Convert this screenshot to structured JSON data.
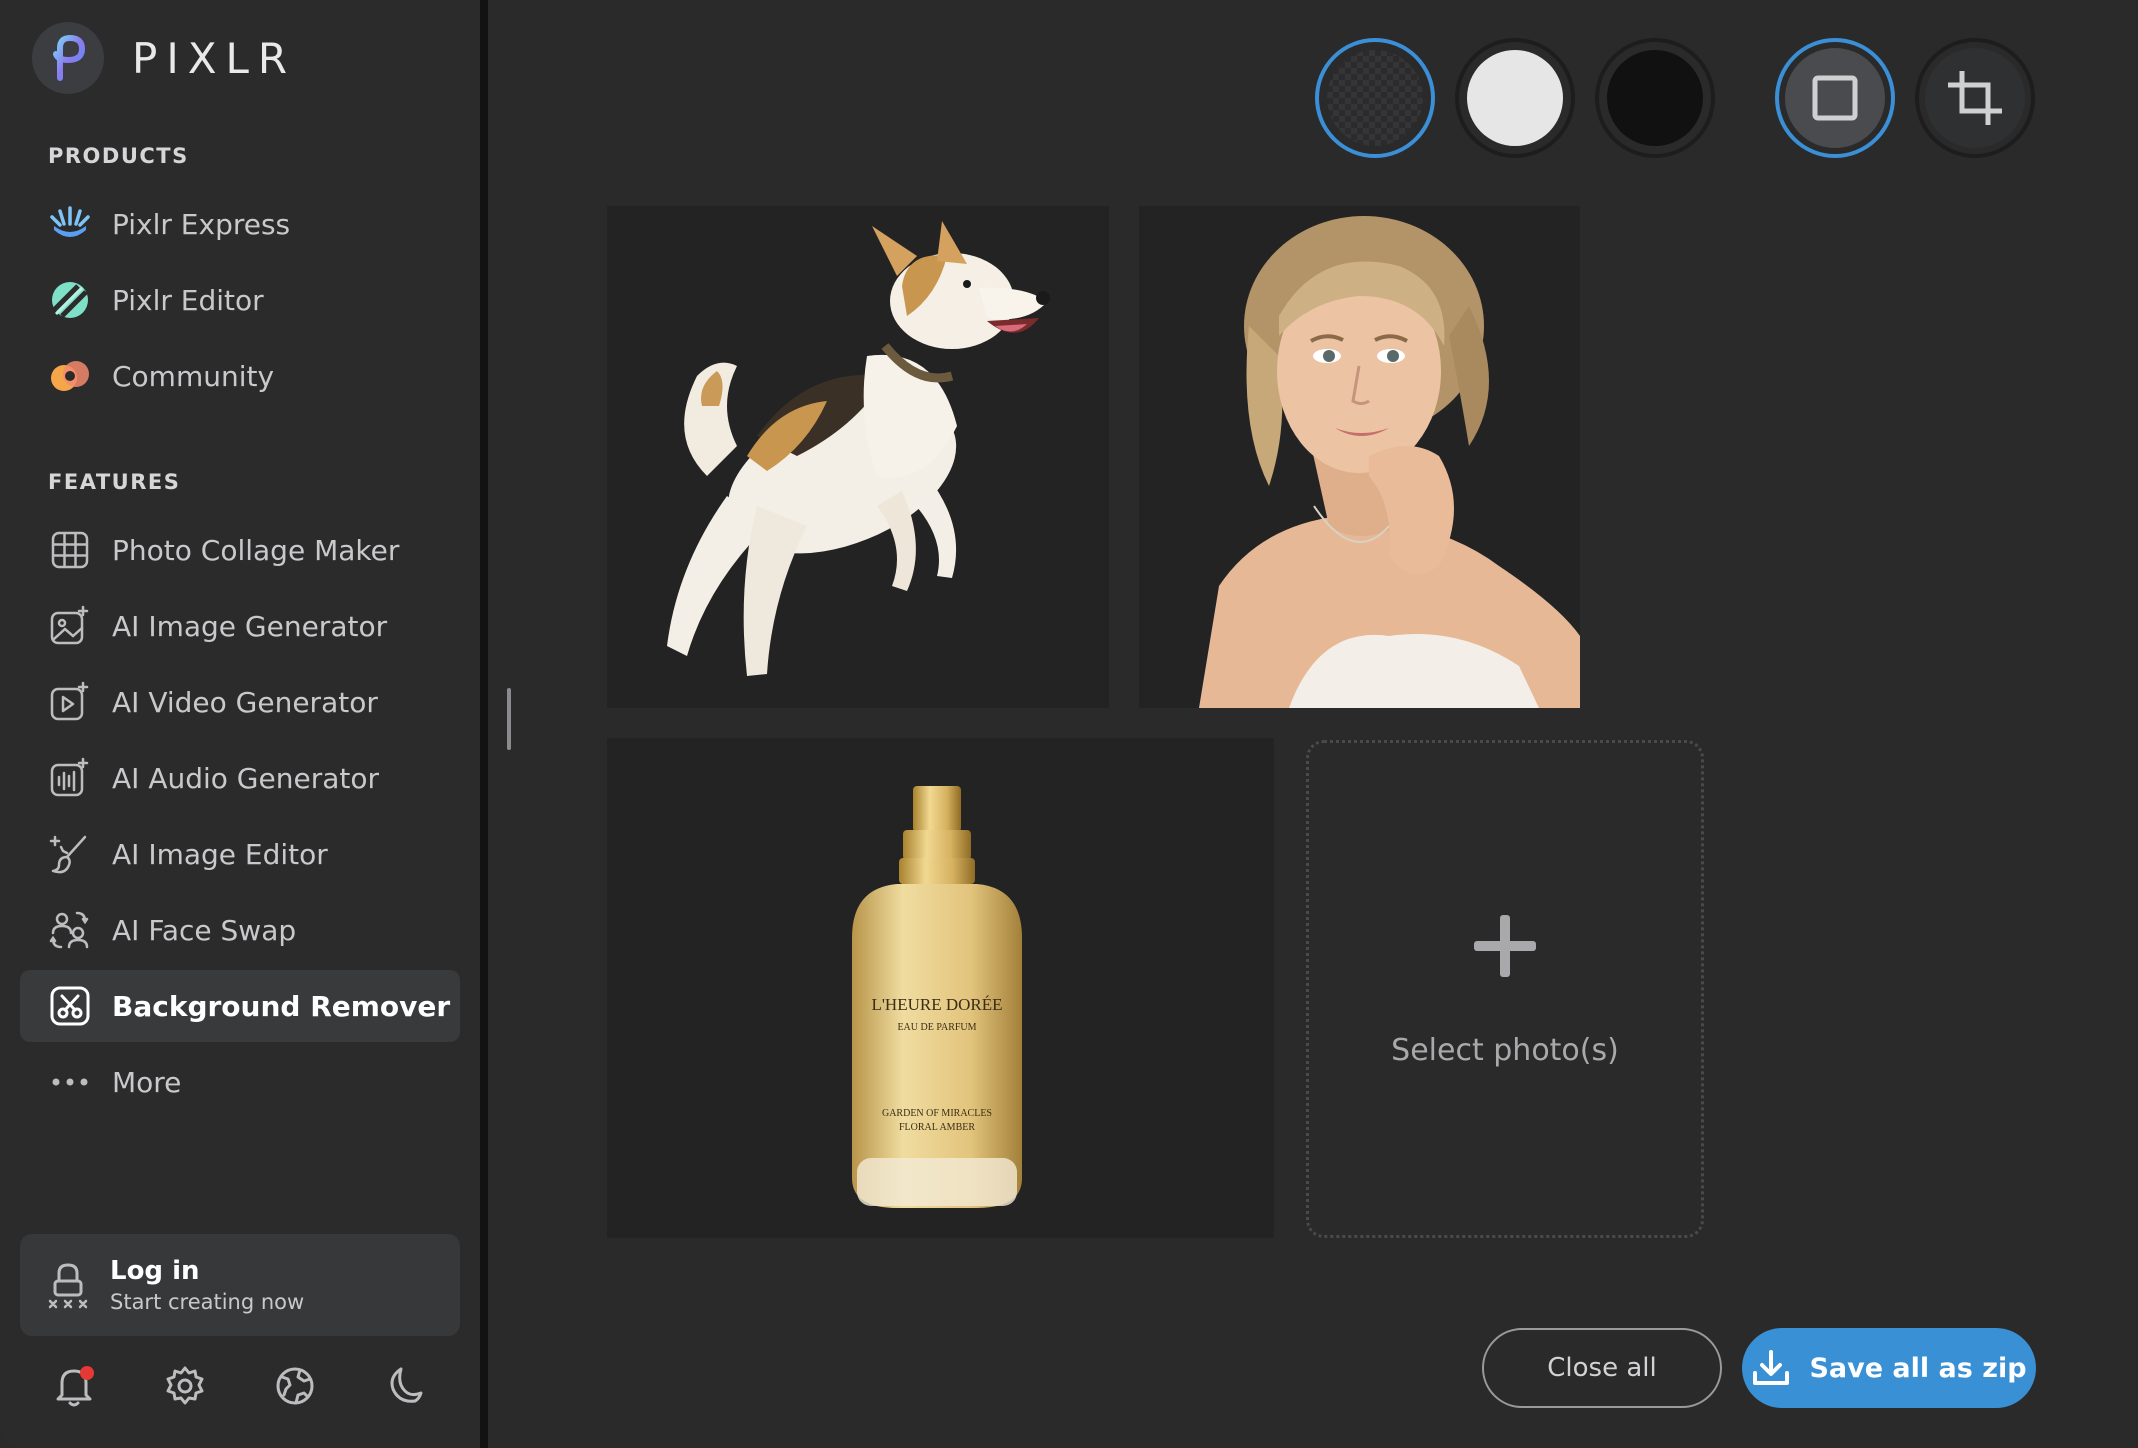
{
  "brand": {
    "name": "PIXLR"
  },
  "sidebar": {
    "products_heading": "PRODUCTS",
    "products": [
      {
        "label": "Pixlr Express",
        "icon": "pixlr-express-icon"
      },
      {
        "label": "Pixlr Editor",
        "icon": "pixlr-editor-icon"
      },
      {
        "label": "Community",
        "icon": "community-icon"
      }
    ],
    "features_heading": "FEATURES",
    "features": [
      {
        "label": "Photo Collage Maker",
        "icon": "grid-icon"
      },
      {
        "label": "AI Image Generator",
        "icon": "ai-image-icon"
      },
      {
        "label": "AI Video Generator",
        "icon": "ai-video-icon"
      },
      {
        "label": "AI Audio Generator",
        "icon": "ai-audio-icon"
      },
      {
        "label": "AI Image Editor",
        "icon": "ai-brush-icon"
      },
      {
        "label": "AI Face Swap",
        "icon": "face-swap-icon"
      },
      {
        "label": "Background Remover",
        "icon": "background-remover-icon",
        "active": true
      },
      {
        "label": "More",
        "icon": "more-dots-icon"
      }
    ],
    "login": {
      "title": "Log in",
      "subtitle": "Start creating now"
    },
    "bottom_icons": [
      "bell-icon",
      "gear-icon",
      "globe-icon",
      "moon-icon"
    ]
  },
  "toolbar": {
    "backgrounds": [
      {
        "name": "transparent",
        "selected": true
      },
      {
        "name": "white",
        "color": "#e6e6e6",
        "selected": false
      },
      {
        "name": "black",
        "color": "#111111",
        "selected": false
      }
    ],
    "tools": [
      {
        "name": "square-frame-icon",
        "selected": true
      },
      {
        "name": "crop-icon",
        "selected": false
      }
    ]
  },
  "gallery": {
    "images": [
      "dog",
      "woman",
      "perfume"
    ],
    "perfume_label_line1": "L'HEURE DORÉE",
    "perfume_label_line2": "EAU DE PARFUM",
    "perfume_label_line3": "GARDEN OF MIRACLES",
    "perfume_label_line4": "FLORAL AMBER",
    "select_label": "Select photo(s)"
  },
  "actions": {
    "close_label": "Close all",
    "save_label": "Save all as zip"
  },
  "colors": {
    "accent": "#3a90d4",
    "sidebar": "#2b2b2c",
    "canvas": "#2a2a2a",
    "notification": "#e53935"
  }
}
